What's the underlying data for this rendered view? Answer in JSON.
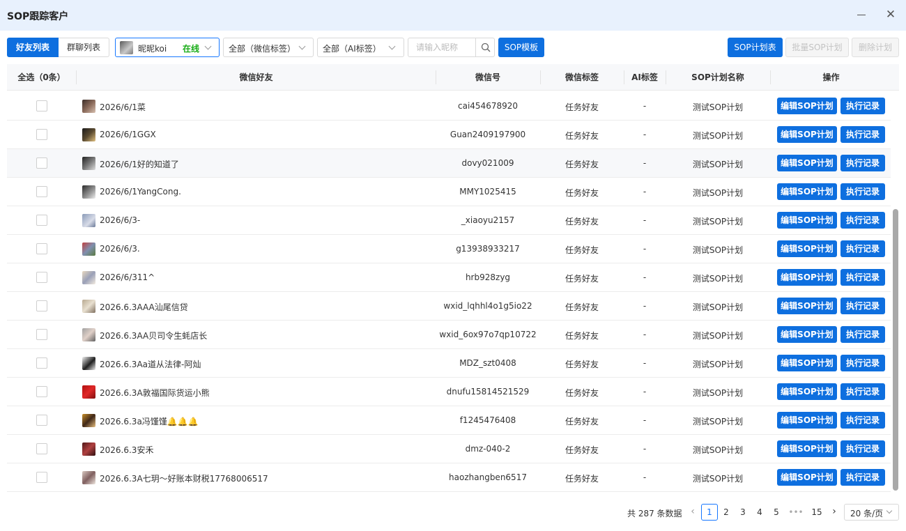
{
  "window": {
    "title": "SOP跟踪客户"
  },
  "tabs": [
    {
      "label": "好友列表",
      "active": true
    },
    {
      "label": "群聊列表",
      "active": false
    }
  ],
  "account": {
    "name": "昵昵koi",
    "status": "在线"
  },
  "filters": {
    "wx_tag": "全部（微信标签）",
    "ai_tag": "全部（AI标签）",
    "search_placeholder": "请输入昵称"
  },
  "buttons": {
    "sop_template": "SOP模板",
    "sop_plan_list": "SOP计划表",
    "batch_sop_plan": "批量SOP计划",
    "delete_plan": "删除计划"
  },
  "table": {
    "columns": {
      "select_all": "全选（0条）",
      "friend": "微信好友",
      "wxid": "微信号",
      "wx_tag": "微信标签",
      "ai_tag": "AI标签",
      "plan_name": "SOP计划名称",
      "actions": "操作"
    },
    "rows": [
      {
        "nickname": "2026/6/1菜",
        "wxid": "cai454678920",
        "wx_tag": "任务好友",
        "ai_tag": "-",
        "plan": "测试SOP计划",
        "edit": "编辑SOP计划",
        "log": "执行记录"
      },
      {
        "nickname": "2026/6/1GGX",
        "wxid": "Guan2409197900",
        "wx_tag": "任务好友",
        "ai_tag": "-",
        "plan": "测试SOP计划",
        "edit": "编辑SOP计划",
        "log": "执行记录"
      },
      {
        "nickname": "2026/6/1好的知道了",
        "wxid": "dovy021009",
        "wx_tag": "任务好友",
        "ai_tag": "-",
        "plan": "测试SOP计划",
        "edit": "编辑SOP计划",
        "log": "执行记录"
      },
      {
        "nickname": "2026/6/1YangCong.",
        "wxid": "MMY1025415",
        "wx_tag": "任务好友",
        "ai_tag": "-",
        "plan": "测试SOP计划",
        "edit": "编辑SOP计划",
        "log": "执行记录"
      },
      {
        "nickname": "2026/6/3-",
        "wxid": "_xiaoyu2157",
        "wx_tag": "任务好友",
        "ai_tag": "-",
        "plan": "测试SOP计划",
        "edit": "编辑SOP计划",
        "log": "执行记录"
      },
      {
        "nickname": "2026/6/3.",
        "wxid": "g13938933217",
        "wx_tag": "任务好友",
        "ai_tag": "-",
        "plan": "测试SOP计划",
        "edit": "编辑SOP计划",
        "log": "执行记录"
      },
      {
        "nickname": "2026/6/311^",
        "wxid": "hrb928zyg",
        "wx_tag": "任务好友",
        "ai_tag": "-",
        "plan": "测试SOP计划",
        "edit": "编辑SOP计划",
        "log": "执行记录"
      },
      {
        "nickname": "2026.6.3AAA汕尾信贷",
        "wxid": "wxid_lqhhl4o1g5io22",
        "wx_tag": "任务好友",
        "ai_tag": "-",
        "plan": "测试SOP计划",
        "edit": "编辑SOP计划",
        "log": "执行记录"
      },
      {
        "nickname": "2026.6.3AA贝司令生蚝店长",
        "wxid": "wxid_6ox97o7qp10722",
        "wx_tag": "任务好友",
        "ai_tag": "-",
        "plan": "测试SOP计划",
        "edit": "编辑SOP计划",
        "log": "执行记录"
      },
      {
        "nickname": "2026.6.3Aa道从法律-阿灿",
        "wxid": "MDZ_szt0408",
        "wx_tag": "任务好友",
        "ai_tag": "-",
        "plan": "测试SOP计划",
        "edit": "编辑SOP计划",
        "log": "执行记录"
      },
      {
        "nickname": "2026.6.3A敦福国际货运小熊",
        "wxid": "dnufu15814521529",
        "wx_tag": "任务好友",
        "ai_tag": "-",
        "plan": "测试SOP计划",
        "edit": "编辑SOP计划",
        "log": "执行记录"
      },
      {
        "nickname": "2026.6.3a冯馑馑🔔🔔🔔",
        "wxid": "f1245476408",
        "wx_tag": "任务好友",
        "ai_tag": "-",
        "plan": "测试SOP计划",
        "edit": "编辑SOP计划",
        "log": "执行记录"
      },
      {
        "nickname": "2026.6.3安禾",
        "wxid": "dmz-040-2",
        "wx_tag": "任务好友",
        "ai_tag": "-",
        "plan": "测试SOP计划",
        "edit": "编辑SOP计划",
        "log": "执行记录"
      },
      {
        "nickname": "2026.6.3A七玥～好账本财税17768006517",
        "wxid": "haozhangben6517",
        "wx_tag": "任务好友",
        "ai_tag": "-",
        "plan": "测试SOP计划",
        "edit": "编辑SOP计划",
        "log": "执行记录"
      }
    ]
  },
  "pagination": {
    "total": "共 287 条数据",
    "pages": [
      "1",
      "2",
      "3",
      "4",
      "5",
      "•••",
      "15"
    ],
    "current": "1",
    "page_size": "20 条/页"
  }
}
